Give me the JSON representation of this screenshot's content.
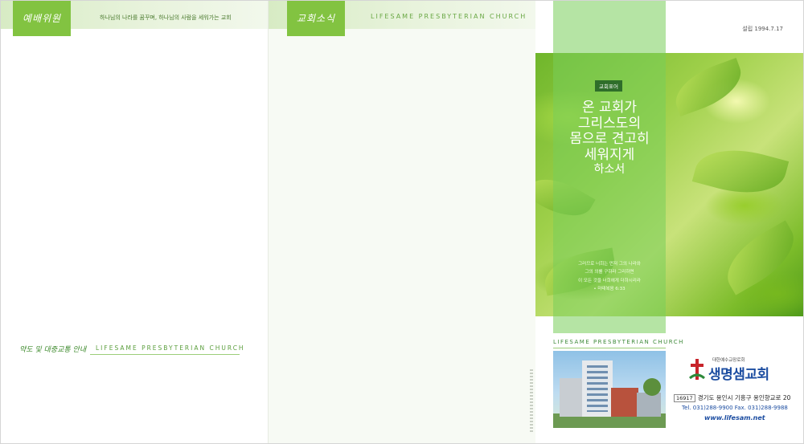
{
  "panel_left": {
    "tab_label": "예배위원",
    "band_text": "하나님의 나라를 꿈꾸며, 하나님의 사람을 세워가는 교회",
    "footer_kr": "약도 및 대중교통 안내",
    "footer_en": "LIFESAME PRESBYTERIAN CHURCH"
  },
  "panel_middle": {
    "tab_label": "교회소식",
    "band_en": "LIFESAME PRESBYTERIAN CHURCH"
  },
  "panel_cover": {
    "founding": "설립 1994.7.17",
    "badge": "교회표어",
    "motto": [
      "온 교회가",
      "그리스도의",
      "몸으로 견고히",
      "세워지게",
      "하소서"
    ],
    "verse": [
      "그러므로 너희는 먼저 그의 나라와",
      "그의 의를 구하라 그리하면",
      "이 모든 것을 너희에게 더하시리라",
      "• 마태복음 6:33"
    ],
    "church_en": "LIFESAME PRESBYTERIAN CHURCH",
    "logo_small": "대한예수교장로회",
    "logo_name": "생명샘교회",
    "zip": "16917",
    "address": "경기도 용인시 기흥구 용인향교로 20",
    "tel": "Tel. 031)288-9900   Fax. 031)288-9988",
    "website": "www.lifesam.net"
  },
  "colors": {
    "accent_green": "#82c341",
    "logo_blue": "#1c4da1",
    "logo_red": "#c8242b"
  }
}
